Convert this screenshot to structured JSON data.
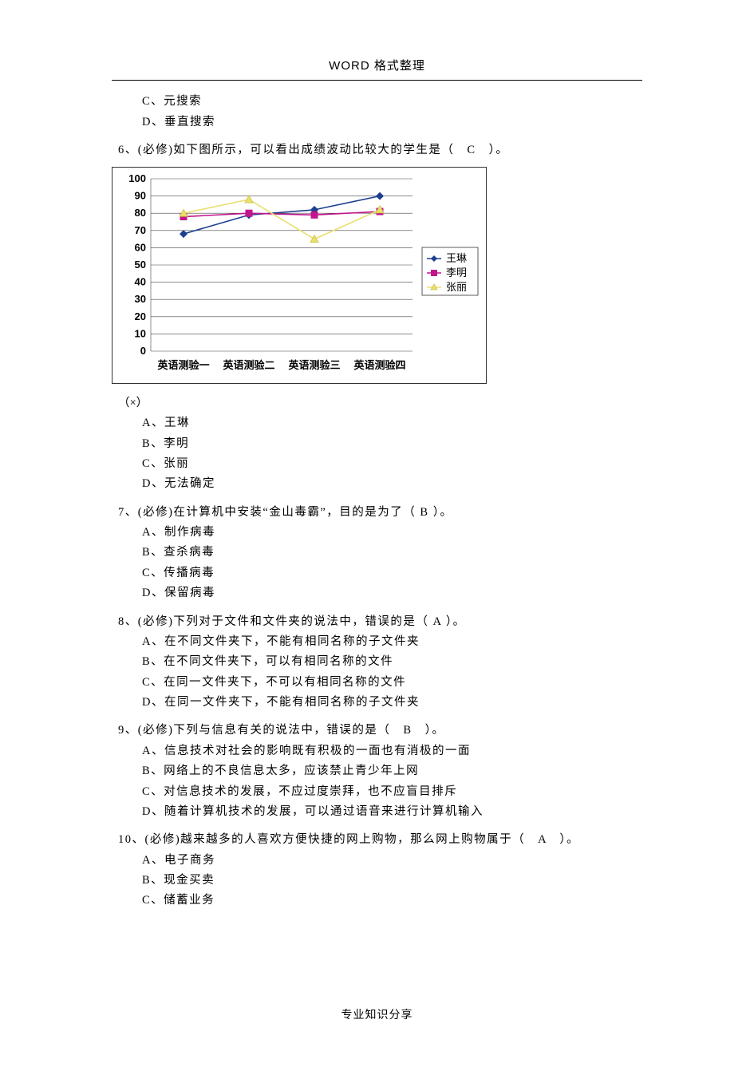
{
  "header": "WORD 格式整理",
  "footer": "专业知识分享",
  "prev_options": {
    "c": "C、元搜索",
    "d": "D、垂直搜索"
  },
  "q6": {
    "stem": "6、(必修)如下图所示，可以看出成绩波动比较大的学生是（　C　）。",
    "note": "（×）",
    "a": "A、王琳",
    "b": "B、李明",
    "c": "C、张丽",
    "d": "D、无法确定"
  },
  "q7": {
    "stem": "7、(必修)在计算机中安装“金山毒霸”，目的是为了（ B ）。",
    "a": "A、制作病毒",
    "b": "B、查杀病毒",
    "c": "C、传播病毒",
    "d": "D、保留病毒"
  },
  "q8": {
    "stem": "8、(必修)下列对于文件和文件夹的说法中，错误的是（ A ）。",
    "a": "A、在不同文件夹下，不能有相同名称的子文件夹",
    "b": "B、在不同文件夹下，可以有相同名称的文件",
    "c": "C、在同一文件夹下，不可以有相同名称的文件",
    "d": "D、在同一文件夹下，不能有相同名称的子文件夹"
  },
  "q9": {
    "stem": "9、(必修)下列与信息有关的说法中，错误的是（　B　）。",
    "a": "A、信息技术对社会的影响既有积极的一面也有消极的一面",
    "b": "B、网络上的不良信息太多，应该禁止青少年上网",
    "c": "C、对信息技术的发展，不应过度崇拜，也不应盲目排斥",
    "d": "D、随着计算机技术的发展，可以通过语音来进行计算机输入"
  },
  "q10": {
    "stem": "10、(必修)越来越多的人喜欢方便快捷的网上购物，那么网上购物属于（　A　）。",
    "a": "A、电子商务",
    "b": "B、现金买卖",
    "c": "C、储蓄业务"
  },
  "chart_data": {
    "type": "line",
    "categories": [
      "英语测验一",
      "英语测验二",
      "英语测验三",
      "英语测验四"
    ],
    "series": [
      {
        "name": "王琳",
        "values": [
          68,
          79,
          82,
          90
        ]
      },
      {
        "name": "李明",
        "values": [
          78,
          80,
          79,
          81
        ]
      },
      {
        "name": "张丽",
        "values": [
          80,
          88,
          65,
          82
        ]
      }
    ],
    "ylim": [
      0,
      100
    ],
    "yticks": [
      0,
      10,
      20,
      30,
      40,
      50,
      60,
      70,
      80,
      90,
      100
    ]
  }
}
